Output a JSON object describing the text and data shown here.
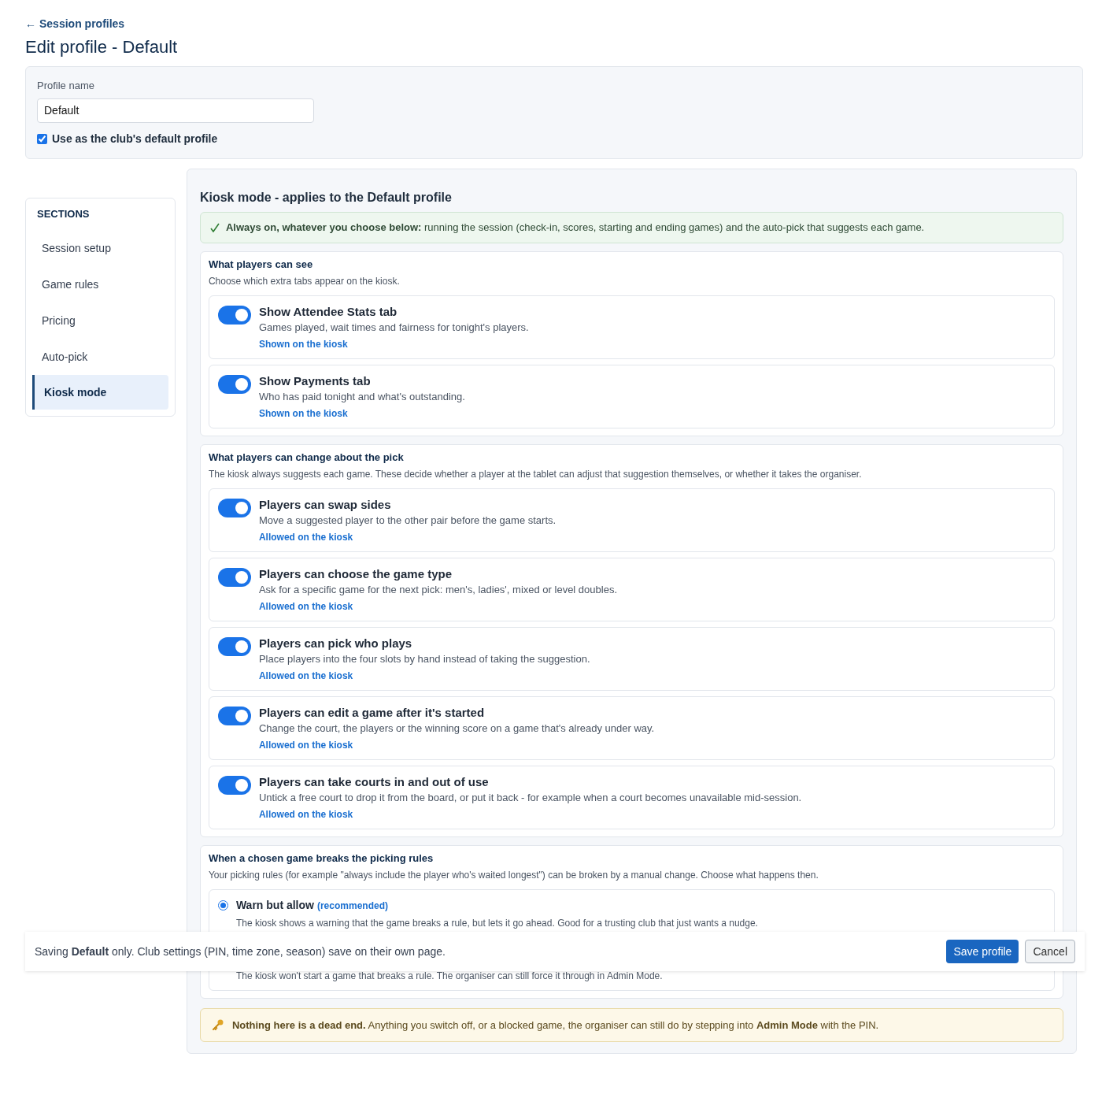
{
  "back_link": {
    "arrow": "←",
    "label": "Session profiles"
  },
  "title": "Edit profile - Default",
  "profile": {
    "label": "Profile name",
    "value": "Default",
    "default_checkbox": {
      "label": "Use as the club's default profile",
      "checked": true
    }
  },
  "sidebar": {
    "heading": "SECTIONS",
    "items": [
      {
        "label": "Session setup",
        "selected": false
      },
      {
        "label": "Game rules",
        "selected": false
      },
      {
        "label": "Pricing",
        "selected": false
      },
      {
        "label": "Auto-pick",
        "selected": false
      },
      {
        "label": "Kiosk mode",
        "selected": true
      }
    ]
  },
  "main": {
    "heading": "Kiosk mode - applies to the Default profile",
    "notice": "**Always on, whatever you choose below:** running the session (check-in, scores, starting and ending games) and the auto-pick that suggests each game.",
    "groups": [
      {
        "kind": "toggles",
        "title": "What players can see",
        "subtitle": "Choose which extra tabs appear on the kiosk.",
        "items": [
          {
            "title": "Show Attendee Stats tab",
            "description": "Games played, wait times and fairness for tonight's players.",
            "on": true,
            "status": "Shown on the kiosk"
          },
          {
            "title": "Show Payments tab",
            "description": "Who has paid tonight and what's outstanding.",
            "on": true,
            "status": "Shown on the kiosk"
          }
        ]
      },
      {
        "kind": "toggles",
        "title": "What players can change about the pick",
        "subtitle": "The kiosk always suggests each game. These decide whether a player at the tablet can adjust that suggestion themselves, or whether it takes the organiser.",
        "items": [
          {
            "title": "Players can swap sides",
            "description": "Move a suggested player to the other pair before the game starts.",
            "on": true,
            "status": "Allowed on the kiosk"
          },
          {
            "title": "Players can choose the game type",
            "description": "Ask for a specific game for the next pick: men's, ladies', mixed or level doubles.",
            "on": true,
            "status": "Allowed on the kiosk"
          },
          {
            "title": "Players can pick who plays",
            "description": "Place players into the four slots by hand instead of taking the suggestion.",
            "on": true,
            "status": "Allowed on the kiosk"
          },
          {
            "title": "Players can edit a game after it's started",
            "description": "Change the court, the players or the winning score on a game that's already under way.",
            "on": true,
            "status": "Allowed on the kiosk"
          },
          {
            "title": "Players can take courts in and out of use",
            "description": "Untick a free court to drop it from the board, or put it back - for example when a court becomes unavailable mid-session.",
            "on": true,
            "status": "Allowed on the kiosk"
          }
        ]
      },
      {
        "kind": "radios",
        "title": "When a chosen game breaks the picking rules",
        "subtitle": "Your picking rules (for example \"always include the player who's waited longest\") can be broken by a manual change. Choose what happens then.",
        "items": [
          {
            "title": "Warn but allow",
            "note": "(recommended)",
            "description": "The kiosk shows a warning that the game breaks a rule, but lets it go ahead. Good for a trusting club that just wants a nudge.",
            "selected": true
          },
          {
            "description": "The kiosk won't start a game that breaks a rule. The organiser can still force it through in Admin Mode."
          }
        ]
      }
    ],
    "tip": "**Nothing here is a dead end.** Anything you switch off, or a blocked game, the organiser can still do by stepping into **Admin Mode** with the PIN."
  },
  "save_bar": {
    "text": "Saving **Default** only. Club settings (PIN, time zone, season) save on their own page.",
    "save": "Save profile",
    "cancel": "Cancel"
  }
}
